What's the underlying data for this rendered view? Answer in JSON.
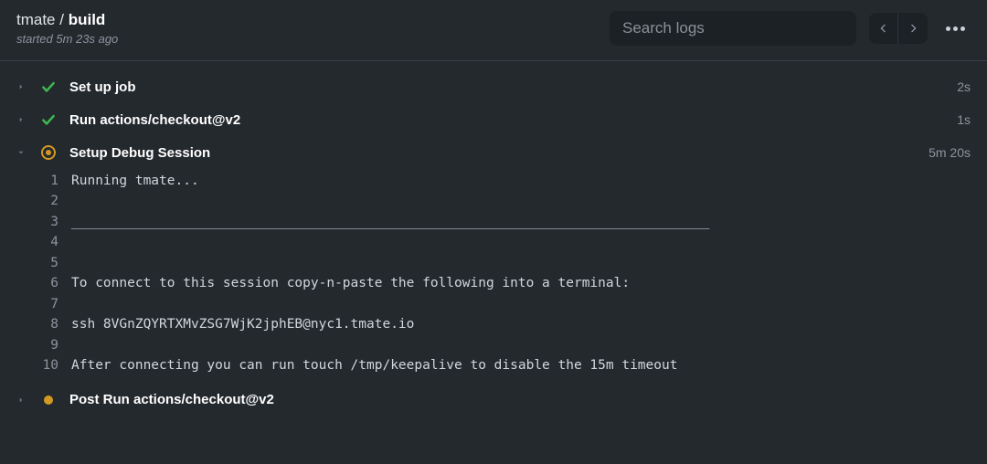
{
  "header": {
    "breadcrumb_prefix": "tmate",
    "breadcrumb_sep": " / ",
    "breadcrumb_current": "build",
    "started_text": "started 5m 23s ago",
    "search_placeholder": "Search logs"
  },
  "steps": [
    {
      "name": "Set up job",
      "time": "2s",
      "status": "success",
      "expanded": false
    },
    {
      "name": "Run actions/checkout@v2",
      "time": "1s",
      "status": "success",
      "expanded": false
    },
    {
      "name": "Setup Debug Session",
      "time": "5m 20s",
      "status": "running",
      "expanded": true
    },
    {
      "name": "Post Run actions/checkout@v2",
      "time": "",
      "status": "queued",
      "expanded": false
    }
  ],
  "log_lines": [
    {
      "n": "1",
      "text": "Running tmate..."
    },
    {
      "n": "2",
      "text": ""
    },
    {
      "n": "3",
      "text": "________________________________________________________________________________"
    },
    {
      "n": "4",
      "text": ""
    },
    {
      "n": "5",
      "text": ""
    },
    {
      "n": "6",
      "text": "To connect to this session copy-n-paste the following into a terminal:"
    },
    {
      "n": "7",
      "text": ""
    },
    {
      "n": "8",
      "text": "ssh 8VGnZQYRTXMvZSG7WjK2jphEB@nyc1.tmate.io"
    },
    {
      "n": "9",
      "text": ""
    },
    {
      "n": "10",
      "text": "After connecting you can run touch /tmp/keepalive to disable the 15m timeout"
    }
  ]
}
